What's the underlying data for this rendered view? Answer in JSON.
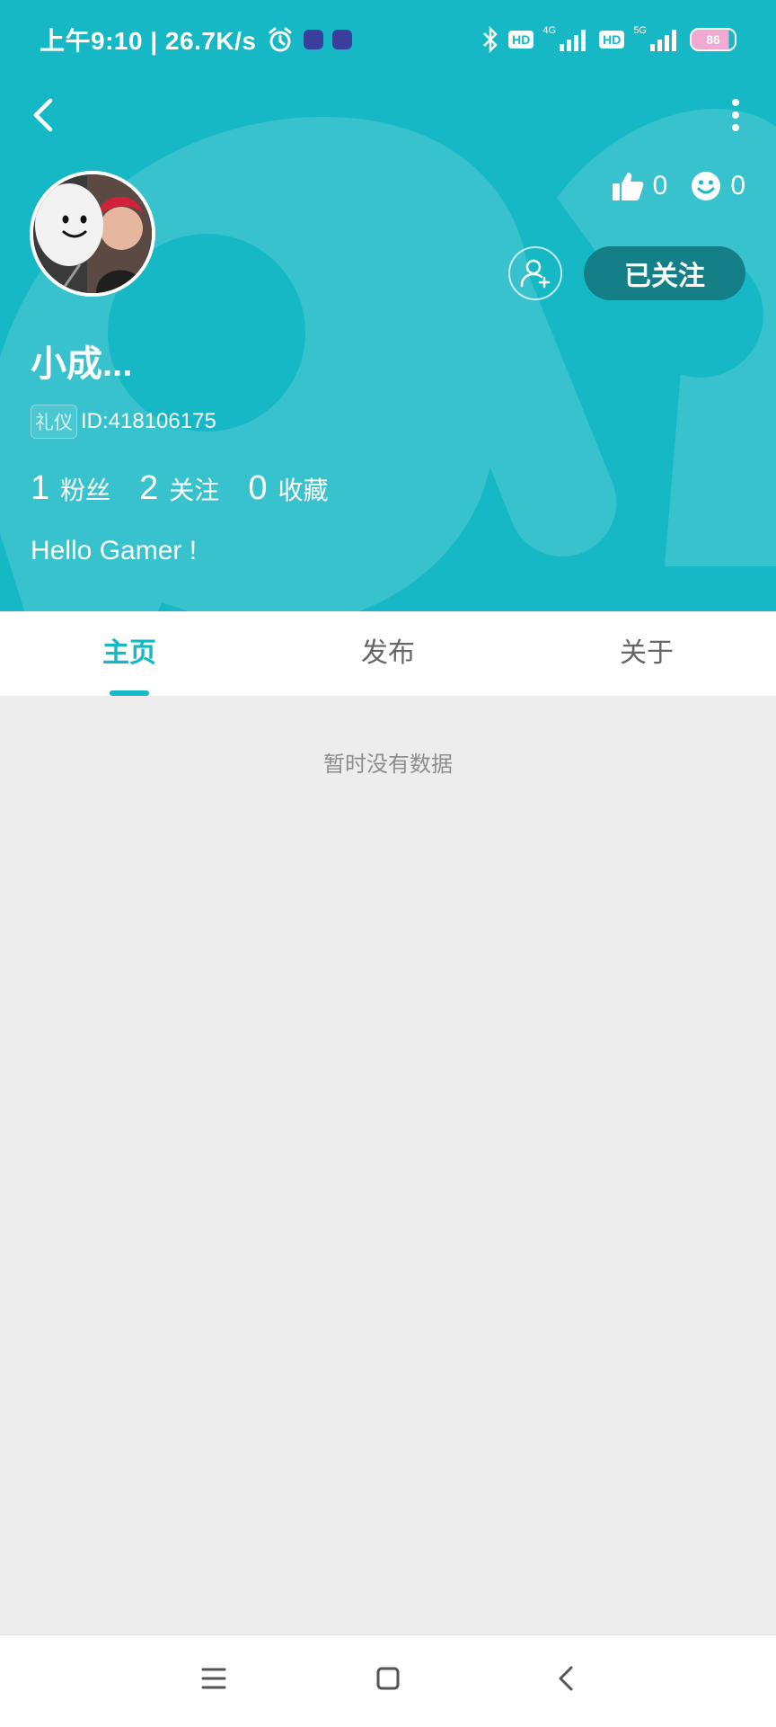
{
  "status_bar": {
    "time_speed": "上午9:10 | 26.7K/s",
    "hd1": "HD",
    "net1": "4G",
    "hd2": "HD",
    "net2": "5G",
    "battery": "86"
  },
  "profile": {
    "name": "小成...",
    "tag": "礼仪",
    "id_text": "ID:418106175",
    "likes": "0",
    "smiles": "0",
    "follow_label": "已关注",
    "bio": "Hello Gamer !",
    "counts": [
      {
        "num": "1",
        "label": "粉丝"
      },
      {
        "num": "2",
        "label": "关注"
      },
      {
        "num": "0",
        "label": "收藏"
      }
    ]
  },
  "tabs": [
    {
      "label": "主页",
      "active": true
    },
    {
      "label": "发布",
      "active": false
    },
    {
      "label": "关于",
      "active": false
    }
  ],
  "content": {
    "empty_text": "暂时没有数据"
  },
  "colors": {
    "brand": "#17b8c6",
    "follow_button": "#147f86",
    "background": "#ededed"
  },
  "icons": [
    "back-icon",
    "more-icon",
    "alarm-icon",
    "bluetooth-icon",
    "signal-icon",
    "like-icon",
    "smile-icon",
    "add-friend-icon",
    "menu-icon",
    "home-icon",
    "nav-back-icon"
  ]
}
